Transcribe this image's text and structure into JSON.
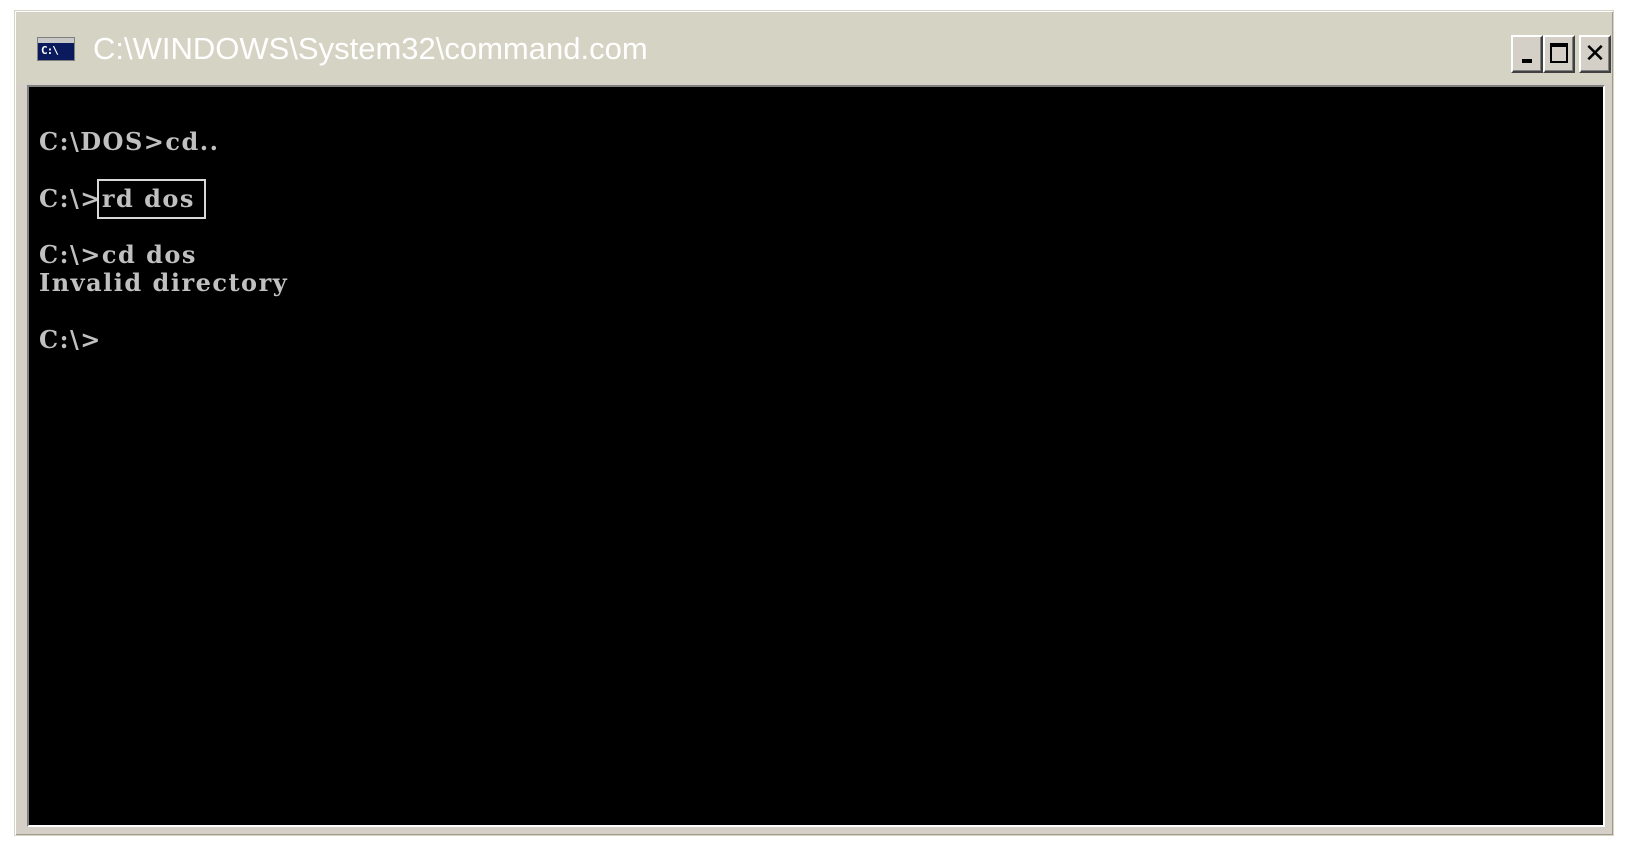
{
  "window": {
    "title": "C:\\WINDOWS\\System32\\command.com",
    "icon_label": "C:\\"
  },
  "controls": {
    "minimize": "minimize-icon",
    "maximize": "maximize-icon",
    "close": "close-icon"
  },
  "console": {
    "line1": "C:\\DOS>cd..",
    "line2_prompt": "C:\\>",
    "line2_command": "rd dos",
    "line3": "C:\\>cd dos",
    "line4": "Invalid directory",
    "line5": "C:\\>"
  },
  "colors": {
    "console_bg": "#000000",
    "console_text": "#c0c0c0",
    "titlebar": "#d5d3c3",
    "title_text": "#ffffff"
  }
}
